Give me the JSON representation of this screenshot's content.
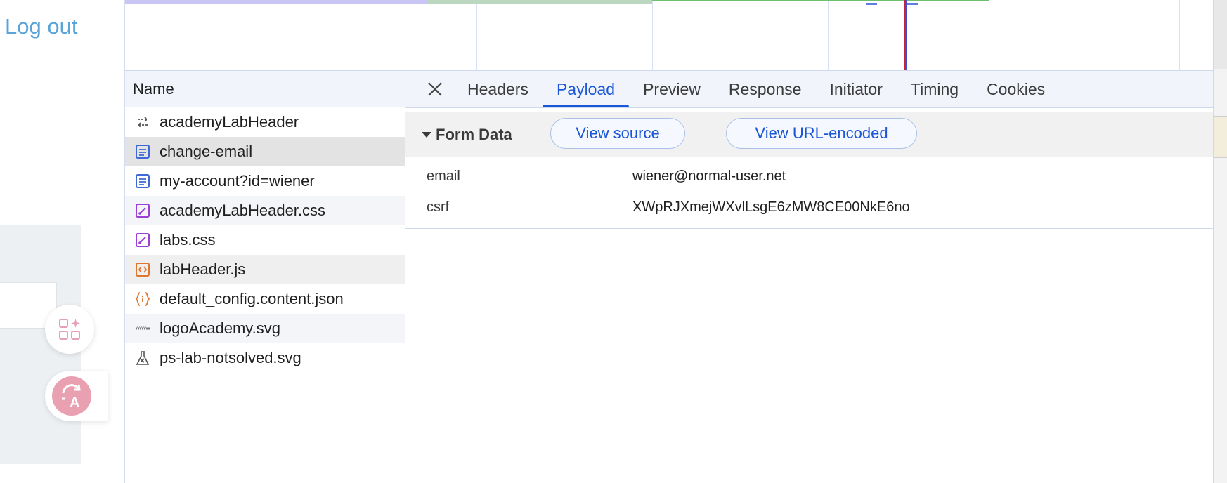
{
  "left_pane": {
    "logout_label": "Log out"
  },
  "devtools": {
    "name_column_header": "Name",
    "requests": [
      {
        "name": "academyLabHeader",
        "icon": "websocket-icon",
        "icon_color": "#555555"
      },
      {
        "name": "change-email",
        "icon": "document-icon",
        "icon_color": "#3d6ad6"
      },
      {
        "name": "my-account?id=wiener",
        "icon": "document-icon",
        "icon_color": "#3d6ad6"
      },
      {
        "name": "academyLabHeader.css",
        "icon": "stylesheet-icon",
        "icon_color": "#9b3fd6"
      },
      {
        "name": "labs.css",
        "icon": "stylesheet-icon",
        "icon_color": "#9b3fd6"
      },
      {
        "name": "labHeader.js",
        "icon": "script-icon",
        "icon_color": "#e0762f"
      },
      {
        "name": "default_config.content.json",
        "icon": "json-icon",
        "icon_color": "#e0762f"
      },
      {
        "name": "logoAcademy.svg",
        "icon": "image-icon",
        "icon_color": "#777777"
      },
      {
        "name": "ps-lab-notsolved.svg",
        "icon": "flask-icon",
        "icon_color": "#555555"
      }
    ],
    "selected_request": "change-email",
    "tabs": [
      {
        "label": "Headers"
      },
      {
        "label": "Payload"
      },
      {
        "label": "Preview"
      },
      {
        "label": "Response"
      },
      {
        "label": "Initiator"
      },
      {
        "label": "Timing"
      },
      {
        "label": "Cookies"
      }
    ],
    "active_tab": "Payload",
    "form_data": {
      "title": "Form Data",
      "view_source_label": "View source",
      "view_url_encoded_label": "View URL-encoded",
      "params": [
        {
          "key": "email",
          "value": "wiener@normal-user.net"
        },
        {
          "key": "csrf",
          "value": "XWpRJXmejWXvlLsgE6zMW8CE00NkE6no"
        }
      ]
    }
  },
  "colors": {
    "accent": "#1a56d6",
    "logout_link": "#5aa4d8"
  }
}
